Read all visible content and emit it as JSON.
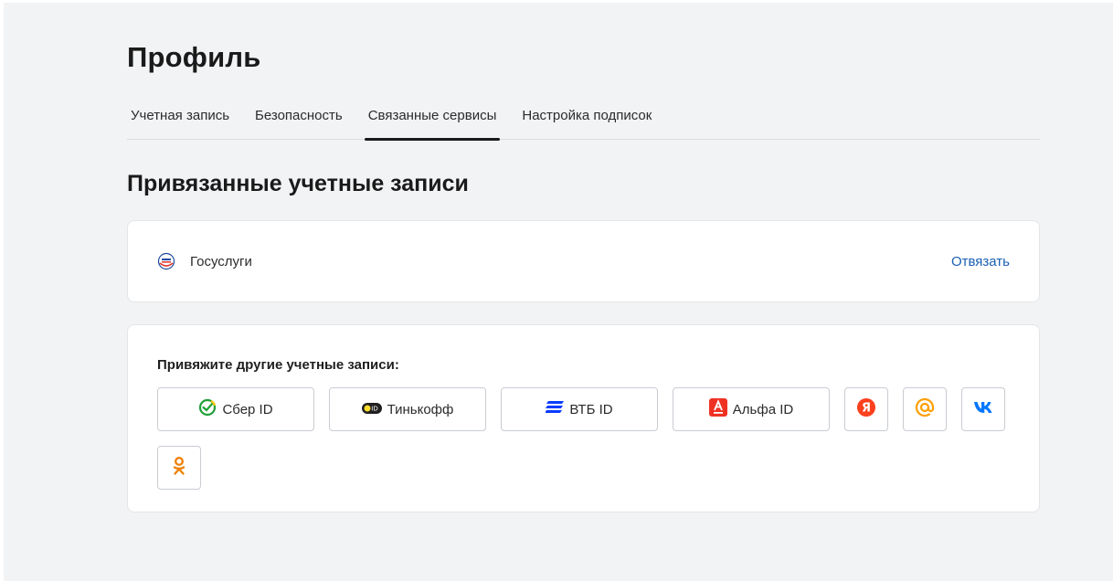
{
  "page": {
    "title": "Профиль"
  },
  "tabs": [
    {
      "label": "Учетная запись",
      "active": false
    },
    {
      "label": "Безопасность",
      "active": false
    },
    {
      "label": "Связанные сервисы",
      "active": true
    },
    {
      "label": "Настройка подписок",
      "active": false
    }
  ],
  "linked": {
    "title": "Привязанные учетные записи",
    "accounts": [
      {
        "name": "Госуслуги",
        "icon": "gosuslugi-icon",
        "action": "Отвязать"
      }
    ]
  },
  "others": {
    "label": "Привяжите другие учетные записи:",
    "services": [
      {
        "label": "Сбер ID",
        "icon": "sber-icon"
      },
      {
        "label": "Тинькофф",
        "icon": "tinkoff-icon"
      },
      {
        "label": "ВТБ ID",
        "icon": "vtb-icon"
      },
      {
        "label": "Альфа ID",
        "icon": "alfa-icon"
      },
      {
        "label": "",
        "icon": "yandex-icon"
      },
      {
        "label": "",
        "icon": "mailru-icon"
      },
      {
        "label": "",
        "icon": "vk-icon"
      },
      {
        "label": "",
        "icon": "odnoklassniki-icon"
      }
    ]
  },
  "colors": {
    "background": "#f2f3f5",
    "card": "#ffffff",
    "link": "#1a5fb4",
    "sber": "#21a038",
    "vtb": "#0a3cff",
    "alfa": "#ef3124",
    "yandex": "#fc3f1d",
    "mailru": "#ff9e00",
    "vk": "#0077ff",
    "ok": "#ee8208"
  }
}
